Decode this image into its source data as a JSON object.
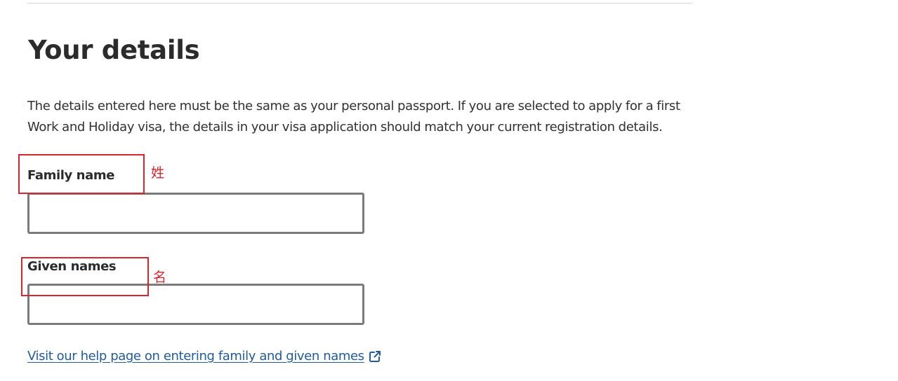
{
  "page": {
    "title": "Your details",
    "intro": "The details entered here must be the same as your personal passport. If you are selected to apply for a first Work and Holiday visa, the details in your visa application should match your current registration details."
  },
  "form": {
    "family_name": {
      "label": "Family name",
      "value": "",
      "annotation": "姓"
    },
    "given_names": {
      "label": "Given names",
      "value": "",
      "annotation": "名"
    }
  },
  "help_link": {
    "text": "Visit our help page on entering family and given names",
    "icon": "external-link-icon"
  },
  "colors": {
    "annotation": "#d9262e",
    "link": "#1f5b9d",
    "input_border": "#7b7b7b"
  }
}
